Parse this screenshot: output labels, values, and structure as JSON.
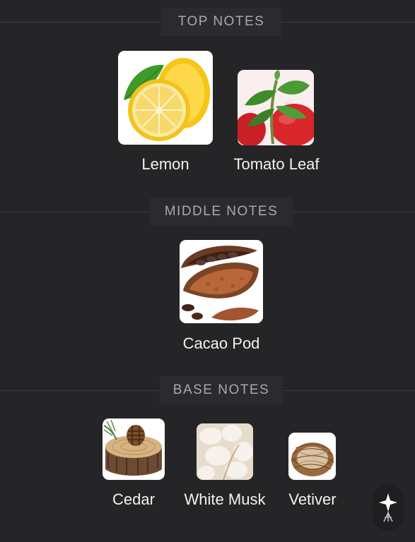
{
  "sections": [
    {
      "title": "TOP NOTES",
      "notes": [
        {
          "name": "Lemon",
          "icon": "lemon-image"
        },
        {
          "name": "Tomato Leaf",
          "icon": "tomato-leaf-image"
        }
      ]
    },
    {
      "title": "MIDDLE NOTES",
      "notes": [
        {
          "name": "Cacao Pod",
          "icon": "cacao-pod-image"
        }
      ]
    },
    {
      "title": "BASE NOTES",
      "notes": [
        {
          "name": "Cedar",
          "icon": "cedar-image"
        },
        {
          "name": "White Musk",
          "icon": "white-musk-image"
        },
        {
          "name": "Vetiver",
          "icon": "vetiver-image"
        }
      ]
    }
  ],
  "colors": {
    "background": "#252527",
    "header_text": "#a9a9ae",
    "label_text": "#f2f2f2"
  }
}
